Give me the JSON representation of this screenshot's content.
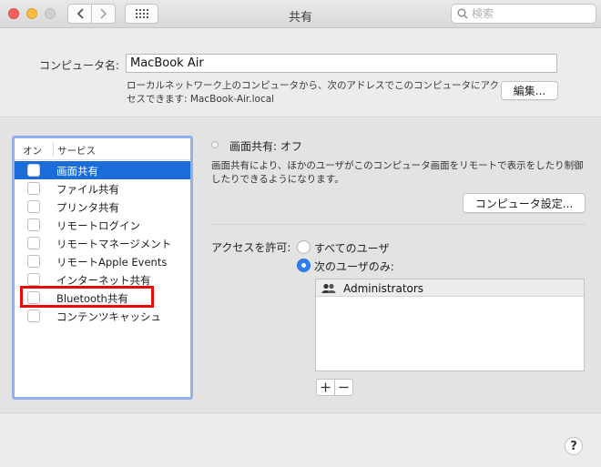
{
  "window": {
    "title": "共有",
    "search_placeholder": "検索"
  },
  "computer": {
    "label": "コンピュータ名:",
    "name": "MacBook Air",
    "description": "ローカルネットワーク上のコンピュータから、次のアドレスでこのコンピュータにアクセスできます: MacBook-Air.local",
    "edit_label": "編集..."
  },
  "services": {
    "header_on": "オン",
    "header_service": "サービス",
    "items": [
      {
        "label": "画面共有"
      },
      {
        "label": "ファイル共有"
      },
      {
        "label": "プリンタ共有"
      },
      {
        "label": "リモートログイン"
      },
      {
        "label": "リモートマネージメント"
      },
      {
        "label": "リモートApple Events"
      },
      {
        "label": "インターネット共有"
      },
      {
        "label": "Bluetooth共有"
      },
      {
        "label": "コンテンツキャッシュ"
      }
    ],
    "selected_index": 0,
    "highlighted_index": 7
  },
  "detail": {
    "status": "画面共有: オフ",
    "description": "画面共有により、ほかのユーザがこのコンピュータ画面をリモートで表示をしたり制御したりできるようになります。",
    "computer_settings_label": "コンピュータ設定...",
    "access_label": "アクセスを許可:",
    "option_all": "すべてのユーザ",
    "option_only": "次のユーザのみ:",
    "users": [
      "Administrators"
    ]
  },
  "colors": {
    "selection": "#1a6cd8",
    "highlight_box": "#e60a0a",
    "radio_on": "#2d7df6"
  }
}
